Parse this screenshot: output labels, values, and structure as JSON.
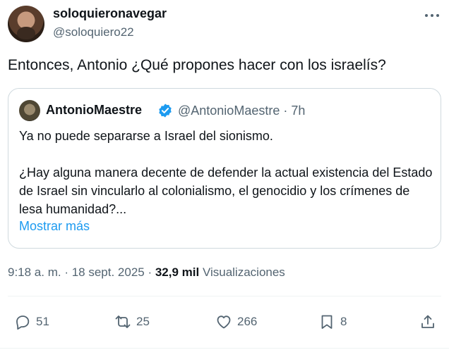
{
  "author": {
    "display_name": "soloquieronavegar",
    "handle": "@soloquiero22"
  },
  "tweet_text": "Entonces, Antonio ¿Qué propones hacer con los israelís?",
  "quote": {
    "display_name": "AntonioMaestre",
    "handle_time": "@AntonioMaestre · 7h",
    "paragraph_1": "Ya no puede separarse a Israel del sionismo.",
    "paragraph_2": "¿Hay alguna manera decente de defender la actual existencia del Estado de Israel sin vincularlo al colonialismo, el genocidio y los crímenes de lesa humanidad?...",
    "show_more": "Mostrar más"
  },
  "meta": {
    "time_date": "9:18 a. m. · 18 sept. 2025 · ",
    "views_count": "32,9 mil",
    "views_label": " Visualizaciones"
  },
  "actions": {
    "replies": "51",
    "reposts": "25",
    "likes": "266",
    "bookmarks": "8"
  },
  "colors": {
    "accent": "#1d9bf0",
    "text": "#0f1419",
    "muted": "#536471",
    "border": "#cfd9de"
  }
}
